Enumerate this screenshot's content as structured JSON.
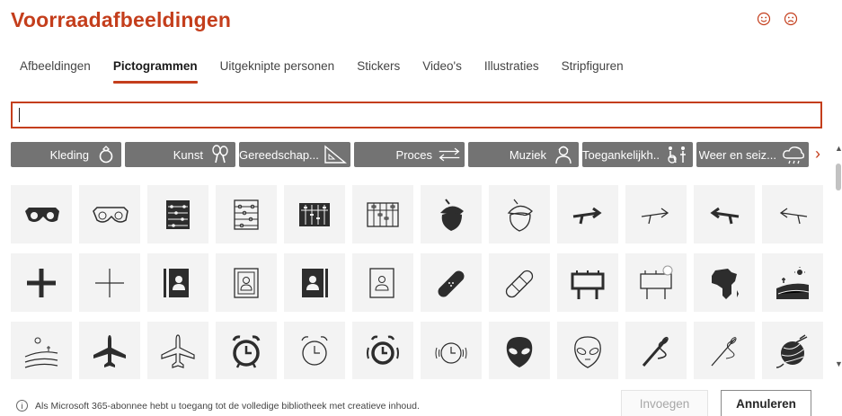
{
  "title": "Voorraadafbeeldingen",
  "feedback": {
    "smile_icon": "smile-face-icon",
    "frown_icon": "frown-face-icon"
  },
  "tabs": [
    {
      "label": "Afbeeldingen",
      "active": false
    },
    {
      "label": "Pictogrammen",
      "active": true
    },
    {
      "label": "Uitgeknipte personen",
      "active": false
    },
    {
      "label": "Stickers",
      "active": false
    },
    {
      "label": "Video's",
      "active": false
    },
    {
      "label": "Illustraties",
      "active": false
    },
    {
      "label": "Stripfiguren",
      "active": false
    }
  ],
  "search": {
    "value": "",
    "placeholder": ""
  },
  "categories": [
    {
      "label": "Kleding",
      "icon": "ring-icon"
    },
    {
      "label": "Kunst",
      "icon": "maracas-icon"
    },
    {
      "label": "Gereedschap...",
      "icon": "set-square-icon"
    },
    {
      "label": "Proces",
      "icon": "process-arrows-icon"
    },
    {
      "label": "Muziek",
      "icon": "musician-icon"
    },
    {
      "label": "Toegankelijkh...",
      "icon": "accessibility-icon"
    },
    {
      "label": "Weer en seiz...",
      "icon": "weather-cloud-icon"
    }
  ],
  "icons": [
    "3d-glasses-filled-icon",
    "3d-glasses-outline-icon",
    "abacus-filled-icon",
    "abacus-outline-icon",
    "abacus-dark-filled-icon",
    "abacus-dark-outline-icon",
    "acorn-filled-icon",
    "acorn-outline-icon",
    "arrow-right-turn-filled-icon",
    "arrow-right-turn-outline-icon",
    "arrow-left-turn-filled-icon",
    "arrow-left-turn-outline-icon",
    "plus-filled-icon",
    "plus-outline-icon",
    "address-book-filled-icon",
    "address-book-outline-icon",
    "address-book-dark-filled-icon",
    "address-book-dark-outline-icon",
    "bandage-filled-icon",
    "bandage-outline-icon",
    "billboard-filled-icon",
    "billboard-outline-icon",
    "africa-map-filled-icon",
    "farm-field-filled-icon",
    "farm-field-outline-icon",
    "airplane-filled-icon",
    "airplane-outline-icon",
    "alarm-clock-filled-icon",
    "alarm-clock-outline-icon",
    "alarm-ringing-filled-icon",
    "alarm-ringing-outline-icon",
    "alien-filled-icon",
    "alien-outline-icon",
    "sewing-needle-filled-icon",
    "sewing-needle-outline-icon",
    "yarn-ball-filled-icon"
  ],
  "footer": {
    "info_text": "Als Microsoft 365-abonnee hebt u toegang tot de volledige bibliotheek met creatieve inhoud.",
    "insert_label": "Invoegen",
    "cancel_label": "Annuleren"
  },
  "colors": {
    "accent": "#c43e1c",
    "chip_bg": "#737373",
    "tile_bg": "#f3f3f3"
  }
}
